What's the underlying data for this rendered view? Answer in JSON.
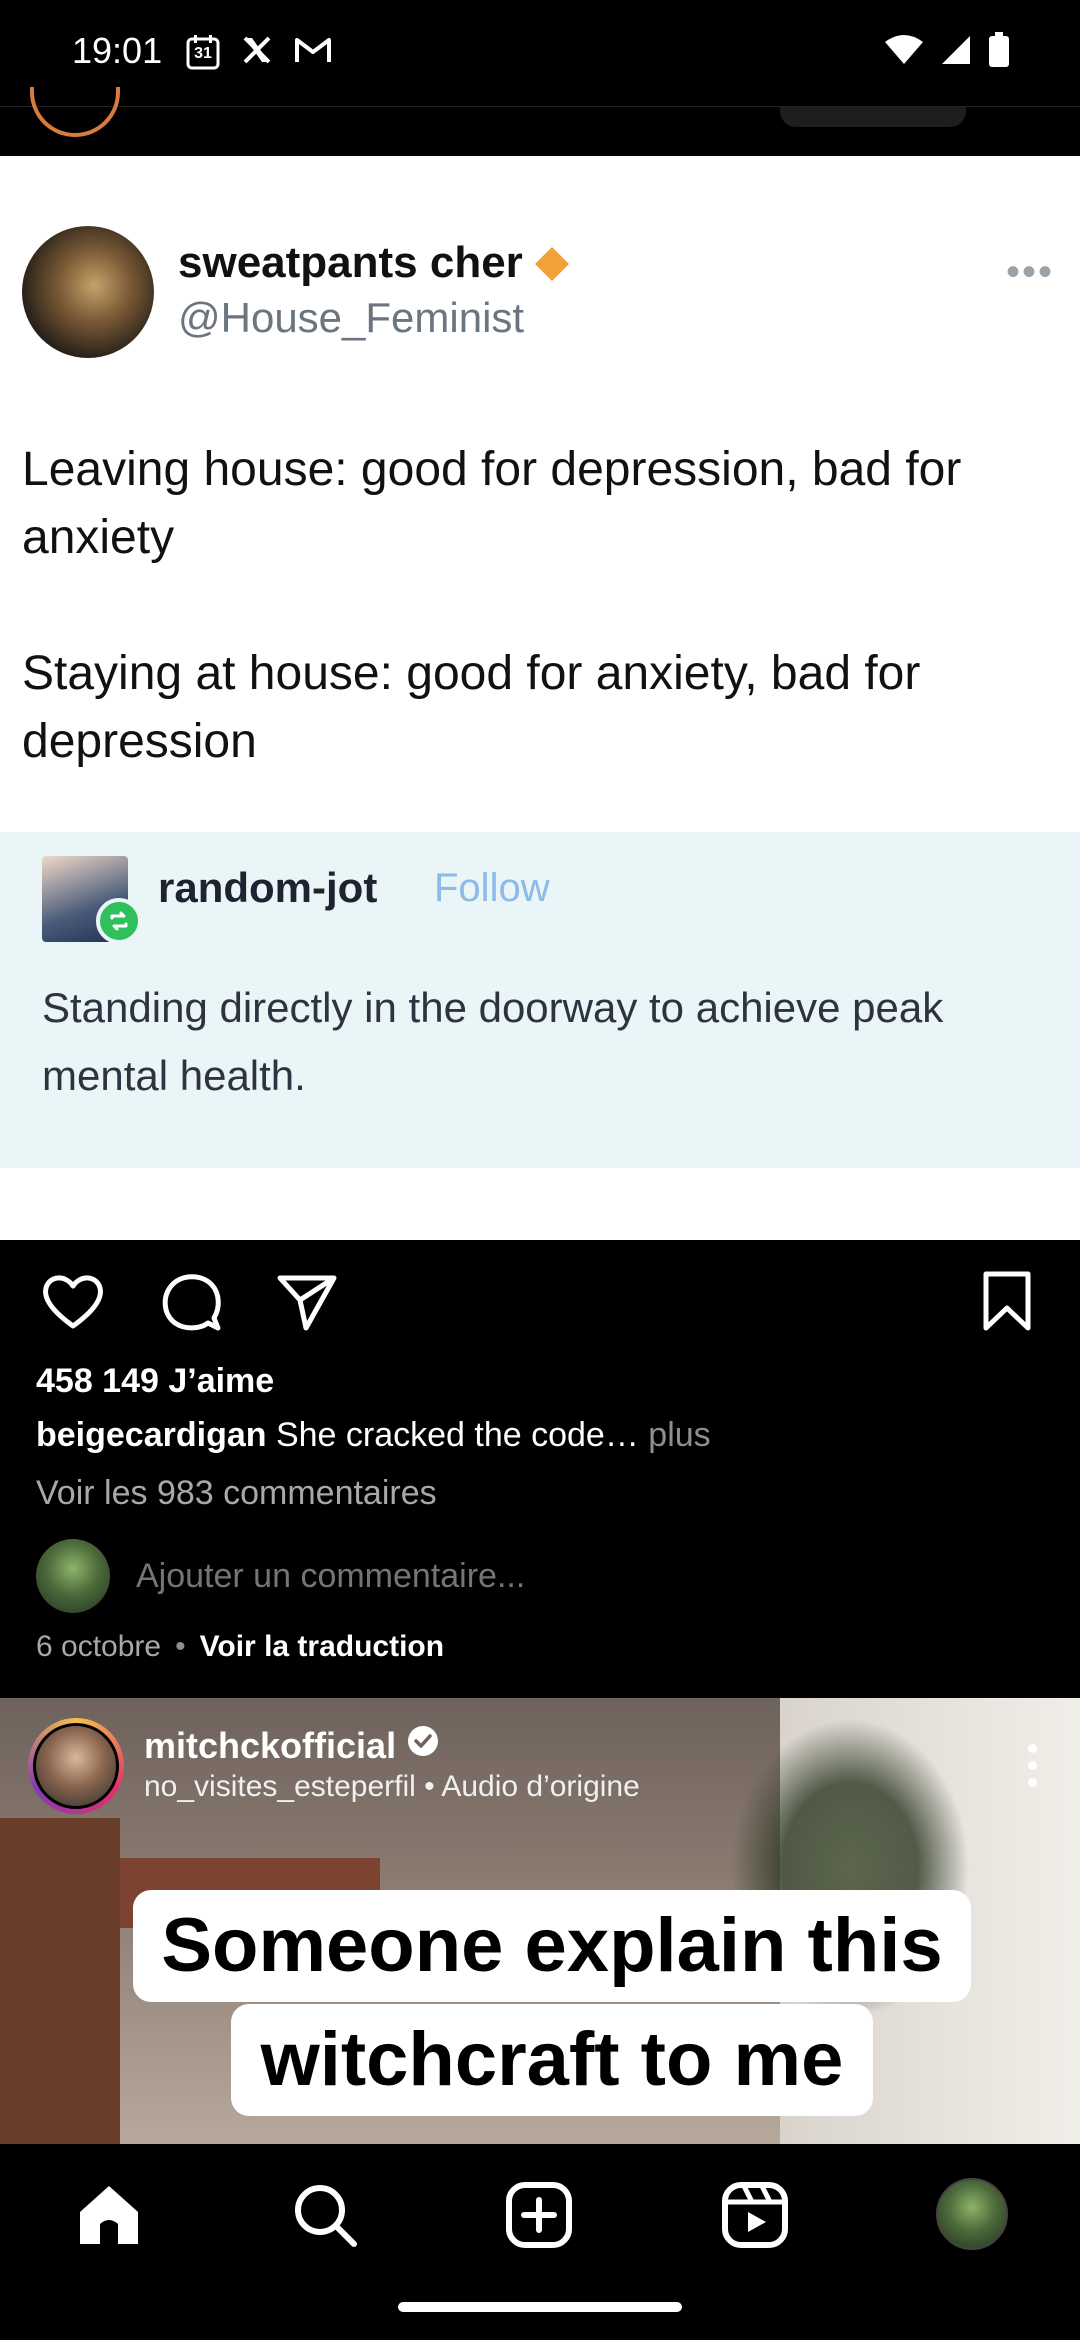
{
  "status_bar": {
    "time": "19:01",
    "left_icons": [
      "calendar-icon",
      "x-icon",
      "gmail-icon"
    ],
    "calendar_date": "31",
    "right_icons": [
      "wifi-icon",
      "signal-icon",
      "battery-icon"
    ]
  },
  "post": {
    "image": {
      "tweet": {
        "name": "sweatpants cher",
        "handle": "@House_Feminist",
        "text": "Leaving house: good for depression, bad for anxiety\n\nStaying at house: good for anxiety, bad for depression"
      },
      "tumblr": {
        "name": "random-jot",
        "follow": "Follow",
        "text": "Standing directly in the doorway to achieve peak mental health."
      }
    },
    "actions": [
      "heart-icon",
      "comment-icon",
      "share-icon",
      "bookmark-icon"
    ],
    "likes": "458 149 J’aime",
    "caption_user": "beigecardigan",
    "caption_text": "She cracked the code",
    "caption_ellipsis": "…",
    "caption_more": " plus",
    "comments_link": "Voir les 983 commentaires",
    "add_comment_placeholder": "Ajouter un commentaire...",
    "date": "6 octobre",
    "separator": "•",
    "translate": "Voir la traduction"
  },
  "next_post": {
    "username": "mitchckofficial",
    "subtitle": "no_visites_esteperfil • Audio d’origine",
    "caption_line1": "Someone explain this",
    "caption_line2": "witchcraft to me"
  },
  "bottom_nav": [
    "home-icon",
    "search-icon",
    "create-icon",
    "reels-icon",
    "profile-avatar"
  ],
  "colors": {
    "background": "#000000",
    "text": "#ffffff",
    "muted": "#a8a8a8",
    "tweet_handle": "#6b7580",
    "tumblr_bg": "#eaf5f7",
    "tumblr_follow": "#8bbbe6",
    "verified_orange": "#f0a13a",
    "reblog_green": "#2fbf5b"
  }
}
